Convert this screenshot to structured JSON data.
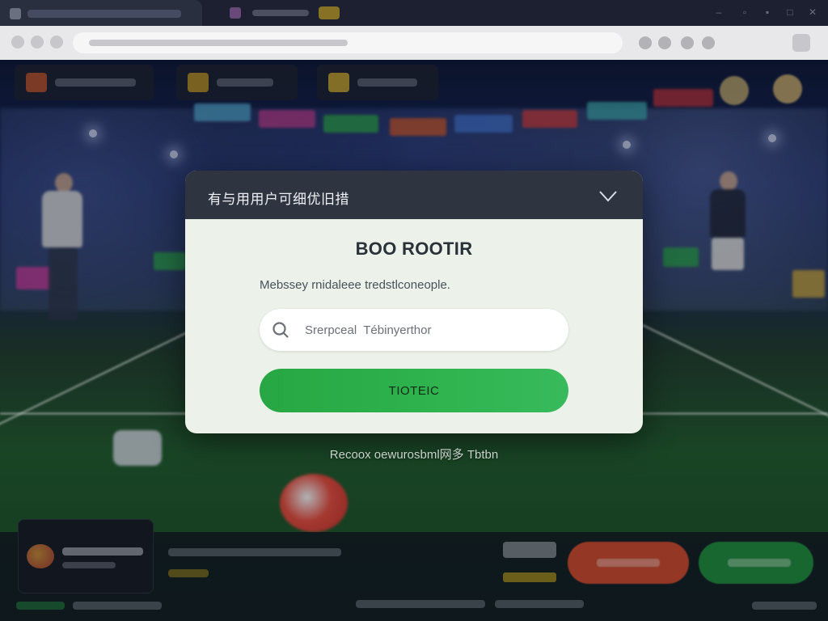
{
  "browser": {
    "tab_icon": "tab-favicon",
    "window_controls": [
      "minimize-icon",
      "maximize-icon",
      "close-icon"
    ]
  },
  "modal": {
    "title": "有与用用户可细优旧措",
    "close_icon": "chevron-down-icon",
    "heading": "BOO ROOTIR",
    "message": "Mebssey rnidaleee tredstlconeople.",
    "search": {
      "icon": "search-icon",
      "placeholder": "Srerpceal  Tébinyerthor"
    },
    "primary_button": "TIOTEIC"
  },
  "below_link": "Recoox oewurosbml网多 Tbtbn",
  "colors": {
    "modal_header": "#2e3440",
    "modal_body": "#ecf2ea",
    "primary_green": "#2fb44f",
    "pitch_green": "#1f5a2a",
    "bottom_orange": "#c9482a",
    "bottom_green": "#1f8a3a"
  }
}
